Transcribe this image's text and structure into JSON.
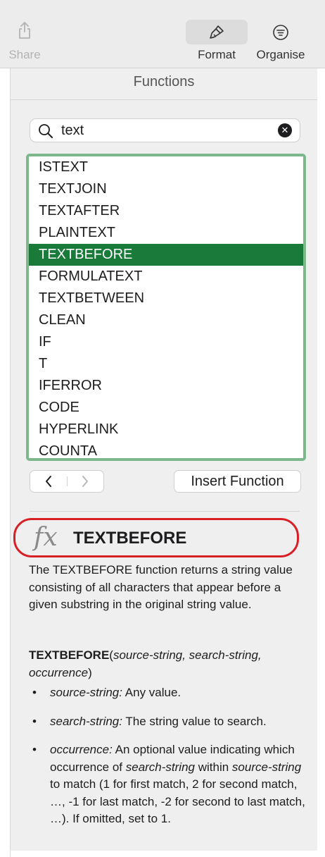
{
  "toolbar": {
    "share_label": "Share",
    "format_label": "Format",
    "organise_label": "Organise",
    "icons": {
      "share": "share-icon",
      "format": "paintbrush-icon",
      "organise": "filter-list-icon"
    }
  },
  "panel": {
    "title": "Functions"
  },
  "search": {
    "value": "text",
    "clear_glyph": "✕"
  },
  "function_list": {
    "items": [
      "ISTEXT",
      "TEXTJOIN",
      "TEXTAFTER",
      "PLAINTEXT",
      "TEXTBEFORE",
      "FORMULATEXT",
      "TEXTBETWEEN",
      "CLEAN",
      "IF",
      "T",
      "IFERROR",
      "CODE",
      "HYPERLINK",
      "COUNTA"
    ],
    "selected": "TEXTBEFORE"
  },
  "navigation": {
    "prev_glyph": "‹",
    "next_glyph": "›"
  },
  "insert_button": {
    "label": "Insert Function"
  },
  "detail": {
    "fx_glyph": "fx",
    "name": "TEXTBEFORE",
    "description": "The TEXTBEFORE function returns a string value consisting of all characters that appear before a given substring in the original string value.",
    "syntax_name": "TEXTBEFORE",
    "syntax_open": "(",
    "syntax_args": "source-string, search-string, occurrence",
    "syntax_close": ")",
    "arguments": [
      {
        "name": "source-string:",
        "text": " Any value."
      },
      {
        "name": "search-string:",
        "text": " The string value to search."
      }
    ],
    "occurrence_arg": {
      "name": "occurrence:",
      "part1": " An optional value indicating which occurrence of ",
      "em1": "search-string",
      "part2": " within ",
      "em2": "source-string",
      "part3": " to match (1 for first match, 2 for second match, …, -1 for last match, -2 for second to last match, …). If omitted, set to 1."
    }
  },
  "colors": {
    "selection": "#197a3a",
    "list_border": "#7cb88a",
    "annotation_ring": "#d81f26"
  }
}
